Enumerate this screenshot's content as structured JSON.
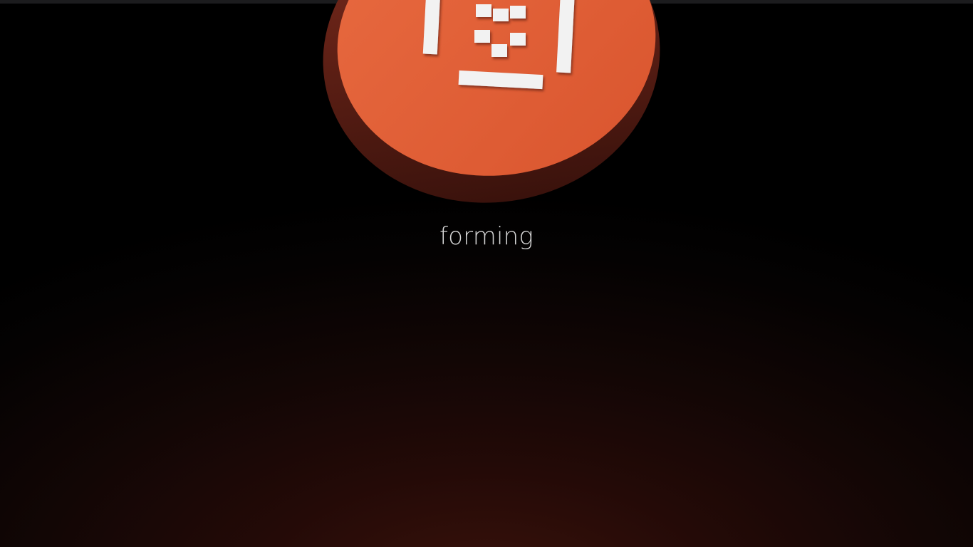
{
  "app": {
    "status_text": "forming"
  },
  "logo": {
    "icon": "pixel-bracket-logo-icon",
    "face_color": "#e2623a",
    "edge_color": "#5a1e14",
    "glyph_color": "#f2f2f2"
  },
  "colors": {
    "background_top": "#000000",
    "background_glow": "#3a120b",
    "status_text": "#d6d6d6"
  }
}
